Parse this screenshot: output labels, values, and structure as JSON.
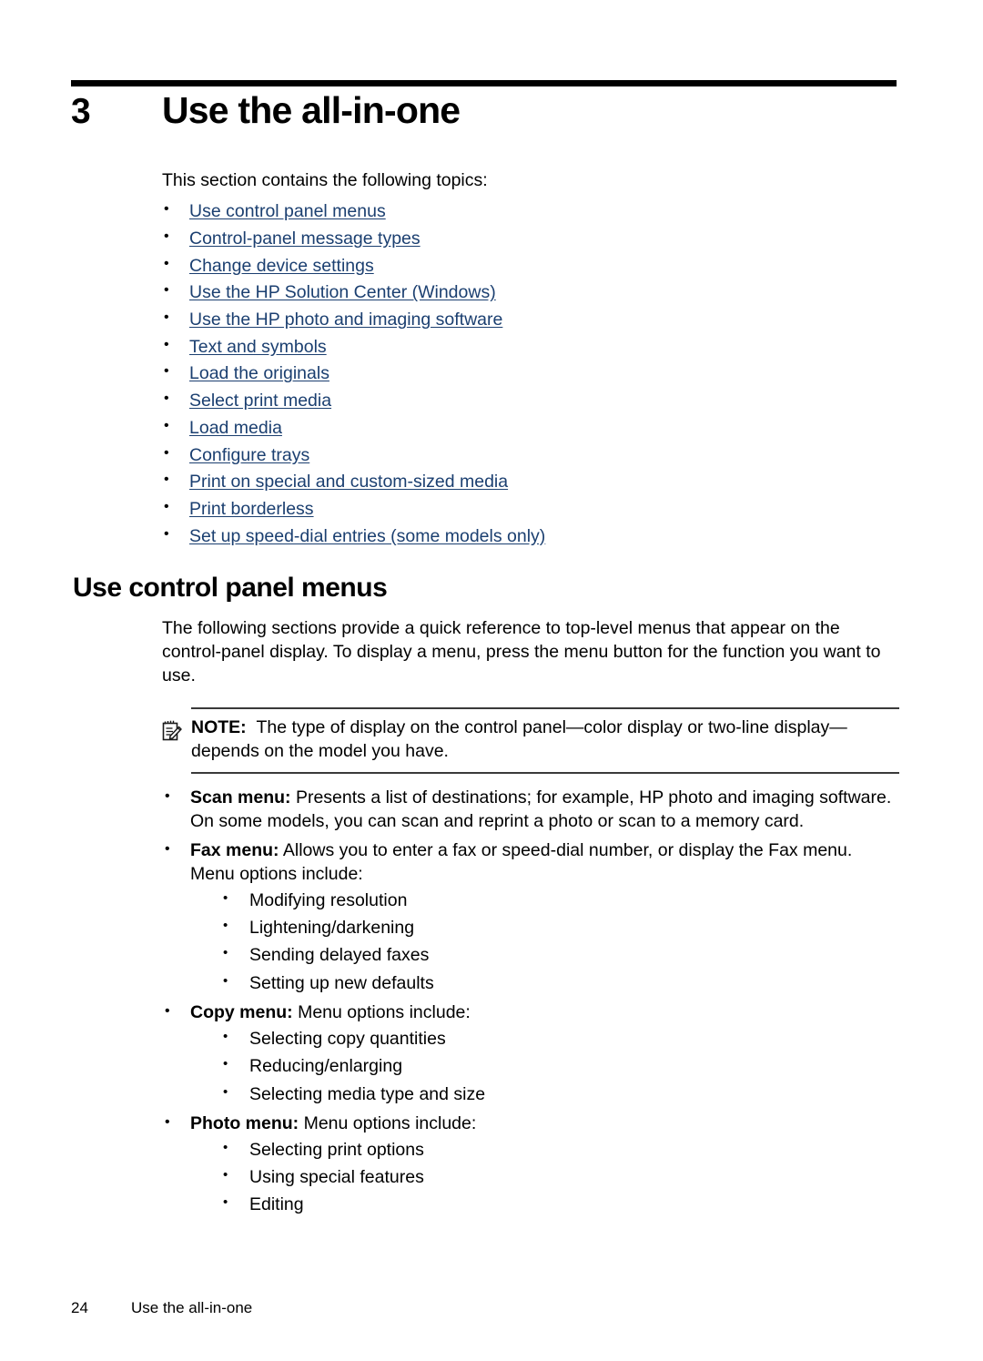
{
  "chapter": {
    "number": "3",
    "title": "Use the all-in-one"
  },
  "intro": "This section contains the following topics:",
  "toc": [
    {
      "label": "Use control panel menus"
    },
    {
      "label": "Control-panel message types"
    },
    {
      "label": "Change device settings"
    },
    {
      "label": "Use the HP Solution Center (Windows)"
    },
    {
      "label": "Use the HP photo and imaging software"
    },
    {
      "label": "Text and symbols"
    },
    {
      "label": "Load the originals"
    },
    {
      "label": "Select print media"
    },
    {
      "label": "Load media"
    },
    {
      "label": "Configure trays"
    },
    {
      "label": "Print on special and custom-sized media"
    },
    {
      "label": "Print borderless"
    },
    {
      "label": "Set up speed-dial entries (some models only)"
    }
  ],
  "section": {
    "heading": "Use control panel menus",
    "paragraph": "The following sections provide a quick reference to top-level menus that appear on the control-panel display. To display a menu, press the menu button for the function you want to use."
  },
  "note": {
    "icon": "note-pencil-icon",
    "label": "NOTE:",
    "text": "The type of display on the control panel—color display or two-line display—depends on the model you have."
  },
  "menus": [
    {
      "term": "Scan menu:",
      "description": " Presents a list of destinations; for example, HP photo and imaging software. On some models, you can scan and reprint a photo or scan to a memory card.",
      "items": []
    },
    {
      "term": "Fax menu:",
      "description": " Allows you to enter a fax or speed-dial number, or display the Fax menu. Menu options include:",
      "items": [
        "Modifying resolution",
        "Lightening/darkening",
        "Sending delayed faxes",
        "Setting up new defaults"
      ]
    },
    {
      "term": "Copy menu:",
      "description": " Menu options include:",
      "items": [
        "Selecting copy quantities",
        "Reducing/enlarging",
        "Selecting media type and size"
      ]
    },
    {
      "term": "Photo menu:",
      "description": " Menu options include:",
      "items": [
        "Selecting print options",
        "Using special features",
        "Editing"
      ]
    }
  ],
  "footer": {
    "page_number": "24",
    "text": "Use the all-in-one"
  },
  "colors": {
    "link": "#1b3f70",
    "rule": "#000000",
    "note_rule": "#3a3a3a",
    "text": "#000000"
  }
}
